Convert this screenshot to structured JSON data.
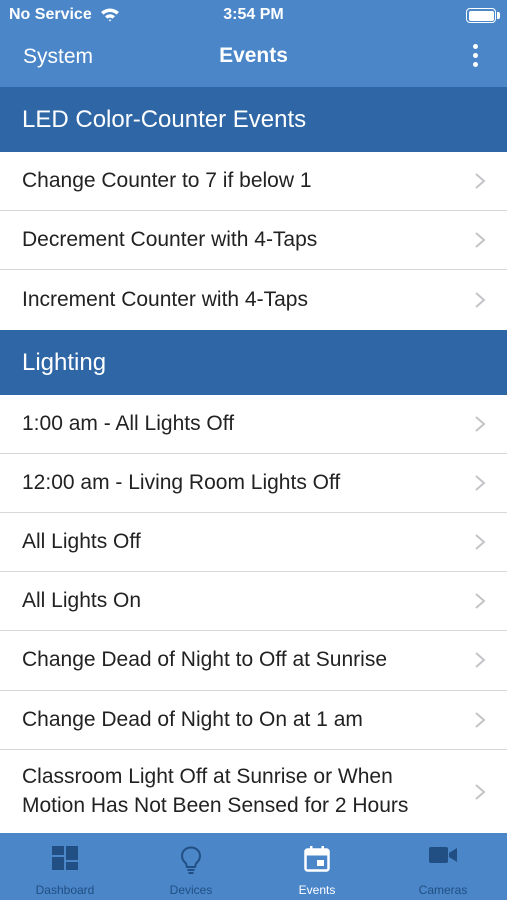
{
  "status": {
    "carrier": "No Service",
    "time": "3:54 PM"
  },
  "nav": {
    "back_label": "System",
    "title": "Events"
  },
  "sections": [
    {
      "title": "LED Color-Counter Events",
      "items": [
        "Change Counter to 7 if below 1",
        "Decrement Counter with 4-Taps",
        "Increment Counter with 4-Taps"
      ]
    },
    {
      "title": "Lighting",
      "items": [
        "1:00 am - All Lights Off",
        "12:00 am - Living Room Lights Off",
        "All Lights Off",
        "All Lights On",
        "Change Dead of Night to Off at Sunrise",
        "Change Dead of Night to On at 1 am",
        "Classroom Light Off at Sunrise or When Motion Has Not Been Sensed for 2 Hours"
      ]
    }
  ],
  "tabs": [
    {
      "label": "Dashboard",
      "icon": "dashboard-icon"
    },
    {
      "label": "Devices",
      "icon": "lightbulb-icon"
    },
    {
      "label": "Events",
      "icon": "calendar-icon",
      "active": true
    },
    {
      "label": "Cameras",
      "icon": "video-camera-icon"
    }
  ],
  "colors": {
    "nav": "#4a86c8",
    "section_header": "#2f67a6",
    "tab_inactive": "#214f83",
    "tab_active": "#ffffff"
  }
}
